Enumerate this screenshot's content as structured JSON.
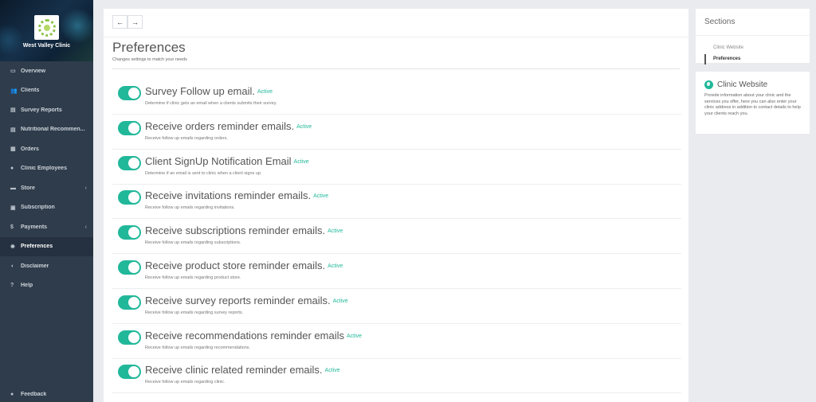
{
  "sidebar": {
    "clinic_name": "West Valley Clinic",
    "items": [
      {
        "label": "Overview",
        "icon": "monitor-icon",
        "glyph": "▭"
      },
      {
        "label": "Clients",
        "icon": "users-icon",
        "glyph": "👥"
      },
      {
        "label": "Survey Reports",
        "icon": "file-icon",
        "glyph": "▤"
      },
      {
        "label": "Nutritional Recommen...",
        "icon": "file-icon",
        "glyph": "▤"
      },
      {
        "label": "Orders",
        "icon": "list-icon",
        "glyph": "▦"
      },
      {
        "label": "Clinic Employees",
        "icon": "user-icon",
        "glyph": "●"
      },
      {
        "label": "Store",
        "icon": "cart-icon",
        "glyph": "▬"
      },
      {
        "label": "Subscription",
        "icon": "briefcase-icon",
        "glyph": "▣"
      },
      {
        "label": "Payments",
        "icon": "dollar-icon",
        "glyph": "$"
      },
      {
        "label": "Preferences",
        "icon": "gear-icon",
        "glyph": "✹"
      },
      {
        "label": "Disclaimer",
        "icon": "shield-icon",
        "glyph": "◖"
      },
      {
        "label": "Help",
        "icon": "question-icon",
        "glyph": "?"
      }
    ],
    "active_index": 9,
    "feedback_label": "Feedback"
  },
  "main": {
    "title": "Preferences",
    "subtitle": "Changes settings to match your needs",
    "status_label": "Active",
    "preferences": [
      {
        "title": "Survey Follow up email.",
        "desc": "Determine if clinic gets an email when a clients submits their survey.",
        "enabled": true
      },
      {
        "title": "Receive orders reminder emails.",
        "desc": "Receive follow up emails regarding orders.",
        "enabled": true
      },
      {
        "title": "Client SignUp Notification Email",
        "desc": "Determine if an email is sent to clinic when a client signs up.",
        "enabled": true
      },
      {
        "title": "Receive invitations reminder emails.",
        "desc": "Receive follow up emails regarding invitations.",
        "enabled": true
      },
      {
        "title": "Receive subscriptions reminder emails.",
        "desc": "Receive follow up emails regarding subscriptions.",
        "enabled": true
      },
      {
        "title": "Receive product store reminder emails.",
        "desc": "Receive follow up emails regarding product store.",
        "enabled": true
      },
      {
        "title": "Receive survey reports reminder emails.",
        "desc": "Receive follow up emails regarding survey reports.",
        "enabled": true
      },
      {
        "title": "Receive recommendations reminder emails",
        "desc": "Receive follow up emails regarding recommendations.",
        "enabled": true
      },
      {
        "title": "Receive clinic related reminder emails.",
        "desc": "Receive follow up emails regarding clinic.",
        "enabled": true
      }
    ]
  },
  "sections": {
    "heading": "Sections",
    "links": [
      "Clinic Website",
      "Preferences"
    ]
  },
  "website": {
    "heading": "Clinic Website",
    "description": "Provide information about your clinic and the services you offer, here you can also enter your clinic address in addition to contact details to help your clients reach you."
  },
  "colors": {
    "accent": "#21b89a",
    "sidebar": "#2f3c4b"
  }
}
